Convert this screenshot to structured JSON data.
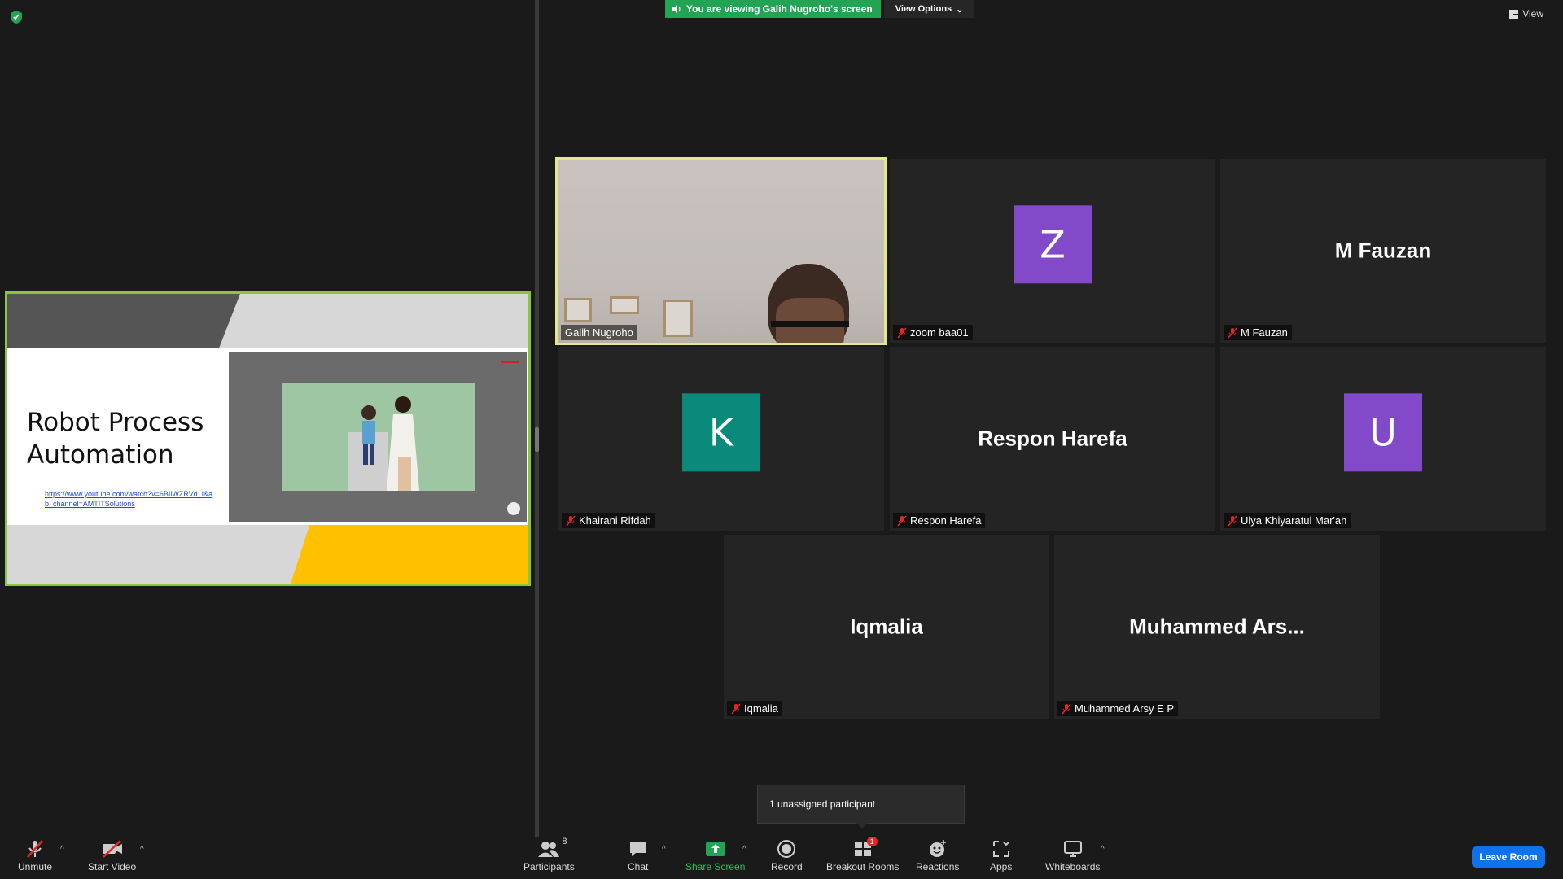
{
  "banner": {
    "viewing_text": "You are viewing Galih Nugroho's screen",
    "view_options_label": "View Options"
  },
  "top_right": {
    "view_label": "View"
  },
  "slide": {
    "title": "Robot Process Automation",
    "link": "https://www.youtube.com/watch?v=6BIiWZRVd_I&ab_channel=AMTITSolutions"
  },
  "participants": [
    {
      "name": "Galih Nugroho",
      "type": "video",
      "active": true
    },
    {
      "name": "zoom baa01",
      "type": "avatar",
      "initial": "Z",
      "avatar_color": "#8249c9"
    },
    {
      "name": "M Fauzan",
      "type": "name",
      "display": "M Fauzan"
    },
    {
      "name": "Khairani Rifdah",
      "type": "avatar",
      "initial": "K",
      "avatar_color": "#0a8a7a"
    },
    {
      "name": "Respon Harefa",
      "type": "name",
      "display": "Respon Harefa"
    },
    {
      "name": "Ulya Khiyaratul Mar'ah",
      "type": "avatar",
      "initial": "U",
      "avatar_color": "#8249c9"
    },
    {
      "name": "Iqmalia",
      "type": "name",
      "display": "Iqmalia"
    },
    {
      "name": "Muhammed Arsy E P",
      "type": "name",
      "display": "Muhammed  Ars..."
    }
  ],
  "popup": {
    "text": "1 unassigned participant"
  },
  "toolbar": {
    "unmute": "Unmute",
    "start_video": "Start Video",
    "participants": "Participants",
    "participants_count": "8",
    "chat": "Chat",
    "share_screen": "Share Screen",
    "record": "Record",
    "breakout_rooms": "Breakout Rooms",
    "breakout_badge": "1",
    "reactions": "Reactions",
    "apps": "Apps",
    "whiteboards": "Whiteboards",
    "leave_room": "Leave Room"
  },
  "colors": {
    "share_green": "#23a455",
    "active_border": "#e6e68a",
    "leave_blue": "#0e72ed",
    "slide_border": "#8ac63e"
  }
}
